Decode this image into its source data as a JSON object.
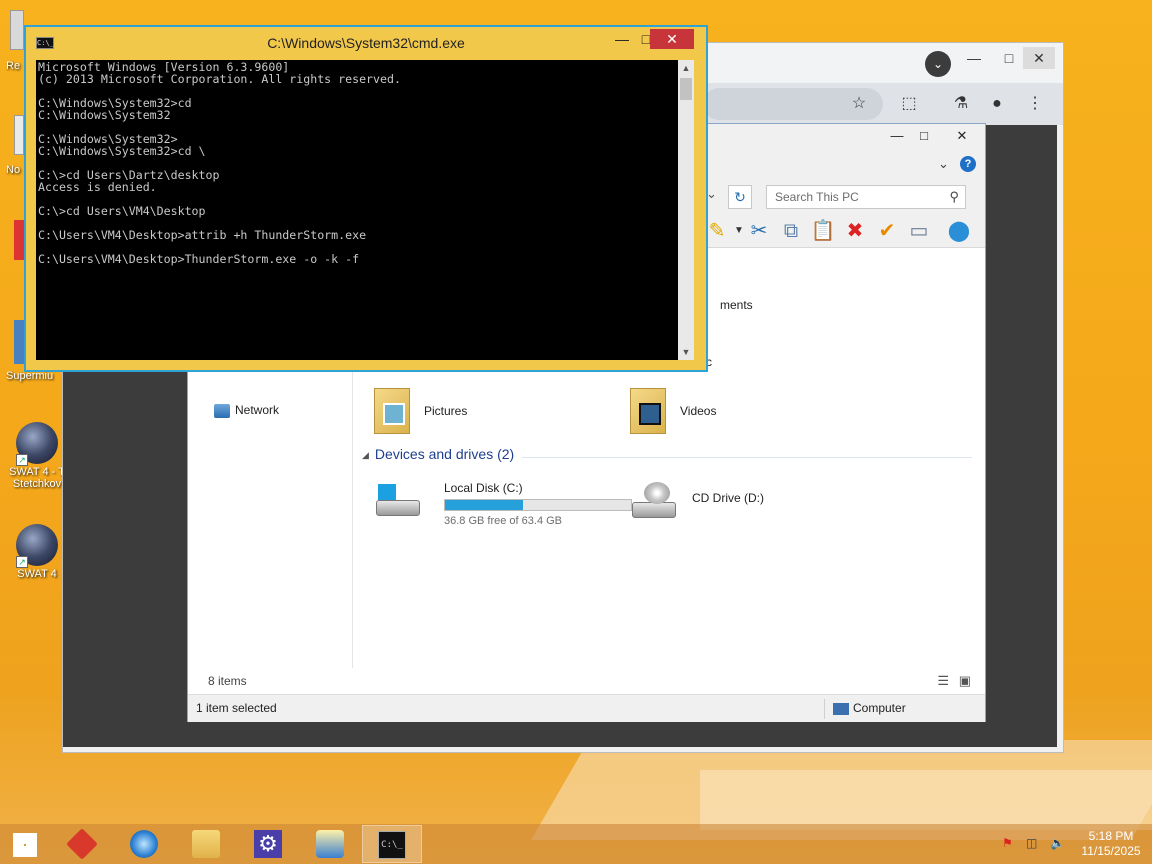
{
  "desktop": {
    "icons": [
      {
        "label_line1": "SWAT 4 - T",
        "label_line2": "Stetchkov"
      },
      {
        "label_line1": "SWAT 4",
        "label_line2": ""
      }
    ],
    "partial_labels": [
      "Re",
      "No",
      "Supermiu"
    ]
  },
  "cmd": {
    "title": "C:\\Windows\\System32\\cmd.exe",
    "minimize": "—",
    "maximize": "□",
    "close": "✕",
    "lines": [
      "Microsoft Windows [Version 6.3.9600]",
      "(c) 2013 Microsoft Corporation. All rights reserved.",
      "",
      "C:\\Windows\\System32>cd",
      "C:\\Windows\\System32",
      "",
      "C:\\Windows\\System32>",
      "C:\\Windows\\System32>cd \\",
      "",
      "C:\\>cd Users\\Dartz\\desktop",
      "Access is denied.",
      "",
      "C:\\>cd Users\\VM4\\Desktop",
      "",
      "C:\\Users\\VM4\\Desktop>attrib +h ThunderStorm.exe",
      "",
      "C:\\Users\\VM4\\Desktop>ThunderStorm.exe -o -k -f"
    ]
  },
  "browser": {
    "profile_badge": "⌄",
    "minimize": "—",
    "maximize": "□",
    "close": "✕",
    "star": "☆",
    "extensions": "⬚",
    "labs": "⚗",
    "account": "●",
    "menu": "⋮"
  },
  "explorer": {
    "minimize": "—",
    "maximize": "□",
    "close": "✕",
    "help": "?",
    "chevron": "⌄",
    "search_placeholder": "Search This PC",
    "refresh": "↻",
    "partial_documents": "ments",
    "partial_music": "c",
    "nav": {
      "network": "Network"
    },
    "folders": [
      {
        "name": "Pictures"
      },
      {
        "name": "Videos"
      }
    ],
    "section_title": "Devices and drives (2)",
    "drives": [
      {
        "name": "Local Disk (C:)",
        "free_text": "36.8 GB free of 63.4 GB",
        "used_fraction": 0.42
      },
      {
        "name": "CD Drive (D:)"
      }
    ],
    "items_count": "8 items",
    "selected": "1 item selected",
    "computer": "Computer"
  },
  "taskbar": {
    "time": "5:18 PM",
    "date": "11/15/2025"
  }
}
